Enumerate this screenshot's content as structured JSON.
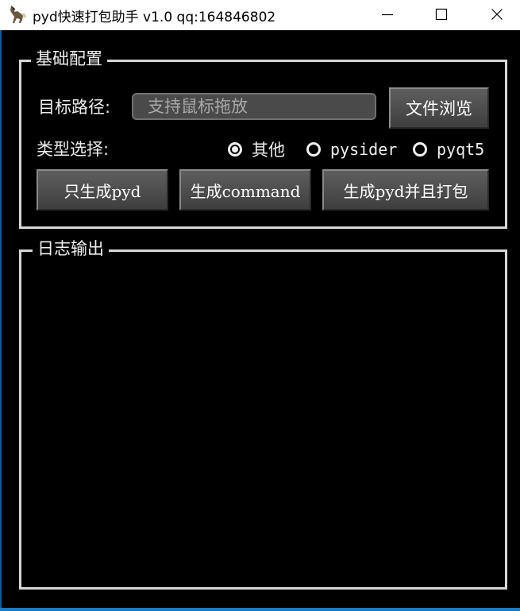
{
  "window": {
    "title": "pyd快速打包助手 v1.0    qq:164846802",
    "app_icon": "horse-icon",
    "controls": {
      "minimize": "minimize-icon",
      "maximize": "maximize-icon",
      "close": "close-icon"
    }
  },
  "basic_config": {
    "group_title": "基础配置",
    "path_label": "目标路径:",
    "path_placeholder": "支持鼠标拖放",
    "path_value": "",
    "browse_label": "文件浏览",
    "type_label": "类型选择:",
    "type_options": [
      {
        "label": "其他",
        "selected": true
      },
      {
        "label": "pysider",
        "selected": false
      },
      {
        "label": "pyqt5",
        "selected": false
      }
    ],
    "actions": {
      "only_pyd": "只生成pyd",
      "command": "生成command",
      "pyd_and_pack": "生成pyd并且打包"
    }
  },
  "log": {
    "group_title": "日志输出",
    "content": ""
  },
  "colors": {
    "background": "#000000",
    "text": "#f0f0f0",
    "group_border": "#d6d6d6",
    "button": "#4e4e4e",
    "accent_bottom": "#1a7bc4"
  }
}
